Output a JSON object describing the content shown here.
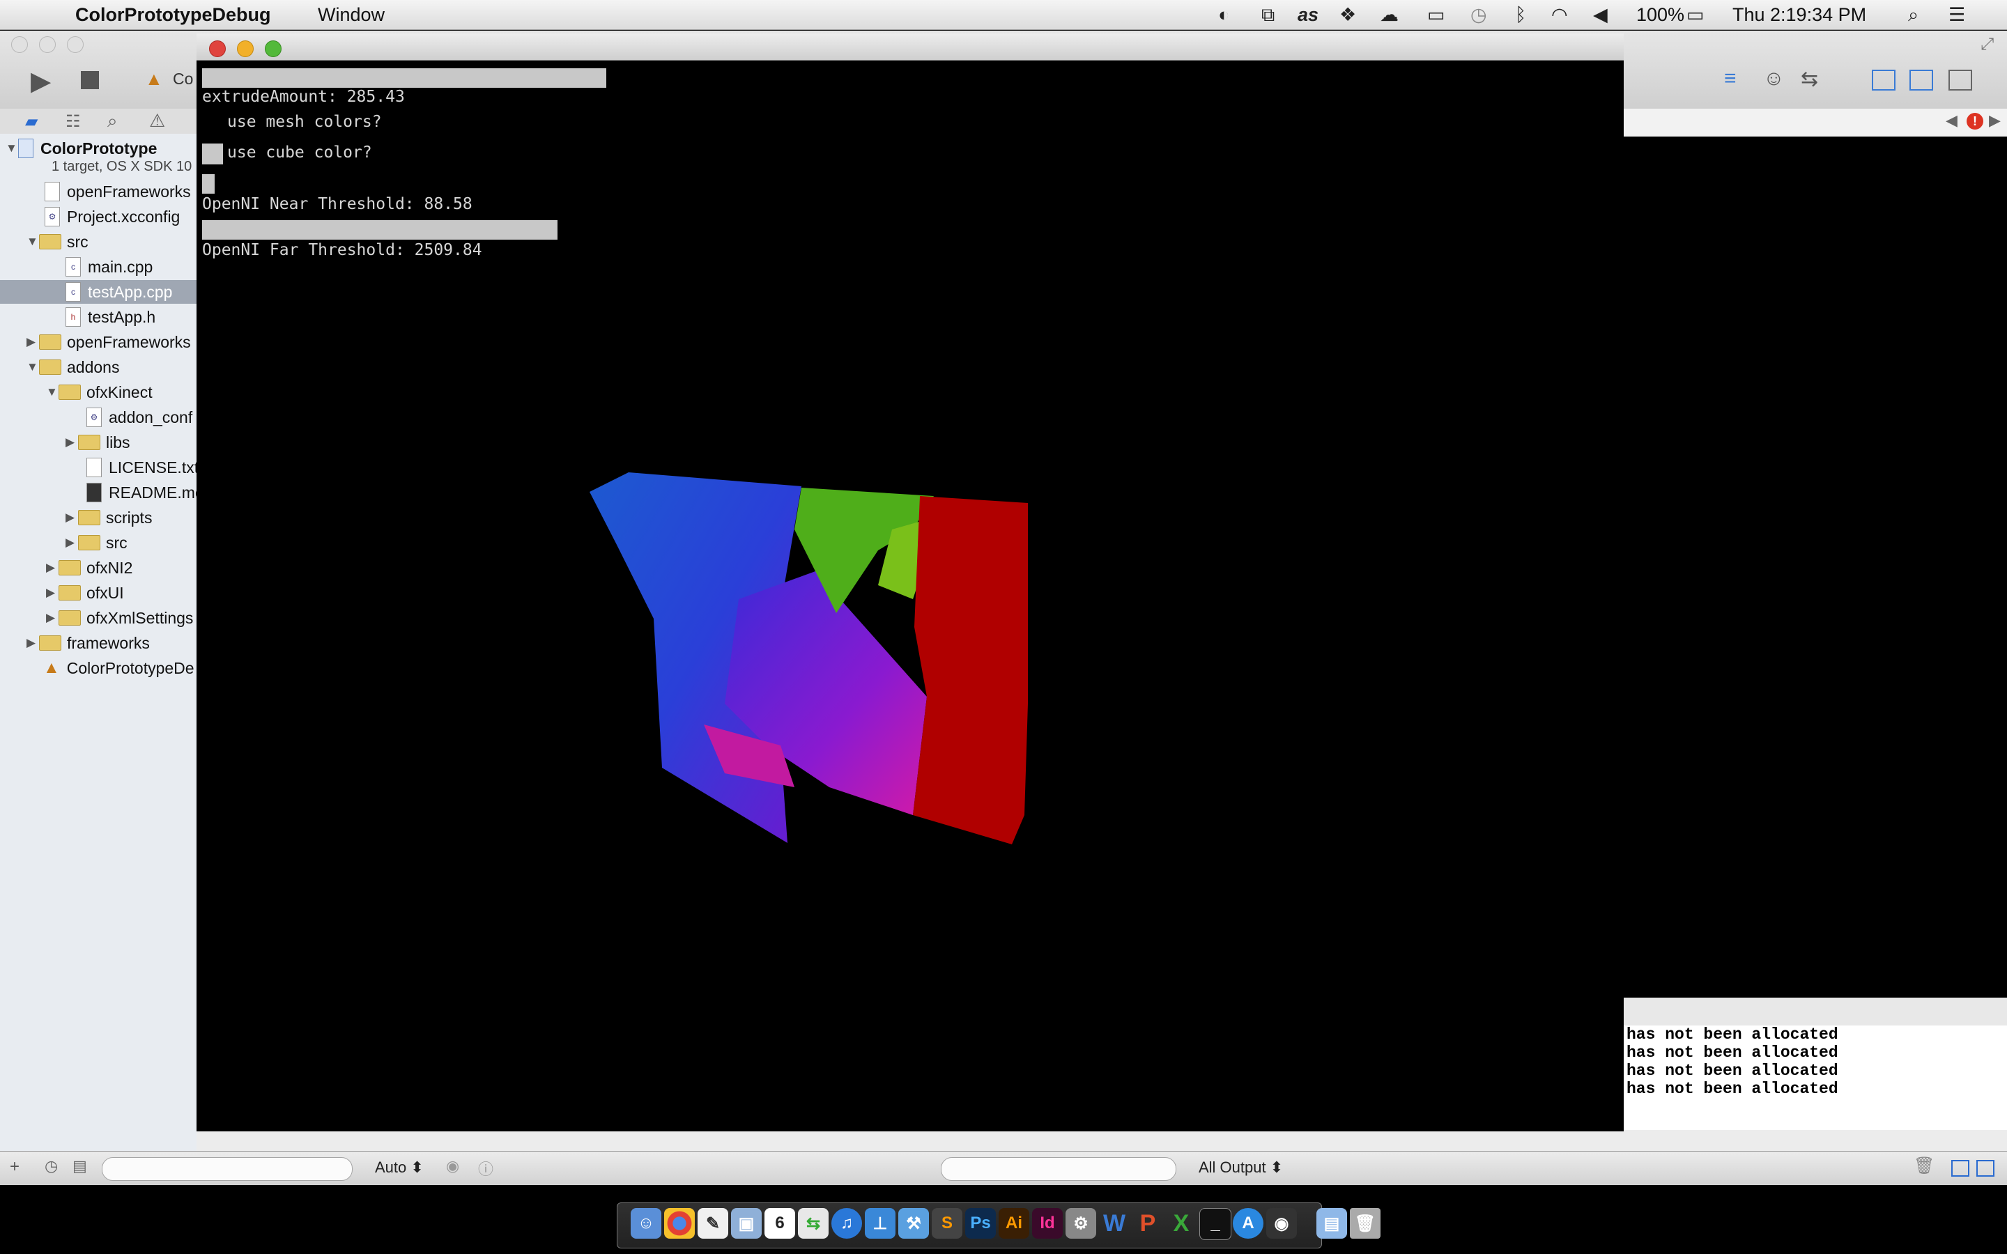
{
  "menubar": {
    "app_name": "ColorPrototypeDebug",
    "menus": [
      "Window"
    ],
    "battery": "100%",
    "clock": "Thu 2:19:34 PM"
  },
  "xcode": {
    "toolbar": {
      "scheme_fragment": "Co"
    },
    "project": {
      "name": "ColorPrototype",
      "subtitle": "1 target, OS X SDK 10"
    },
    "tree": [
      {
        "label": "openFrameworks",
        "kind": "file"
      },
      {
        "label": "Project.xcconfig",
        "kind": "file"
      },
      {
        "label": "src",
        "kind": "folder"
      },
      {
        "label": "main.cpp",
        "kind": "file"
      },
      {
        "label": "testApp.cpp",
        "kind": "file",
        "selected": true
      },
      {
        "label": "testApp.h",
        "kind": "file"
      },
      {
        "label": "openFrameworks",
        "kind": "folder"
      },
      {
        "label": "addons",
        "kind": "folder"
      },
      {
        "label": "ofxKinect",
        "kind": "folder"
      },
      {
        "label": "addon_conf",
        "kind": "file"
      },
      {
        "label": "libs",
        "kind": "folder"
      },
      {
        "label": "LICENSE.txt",
        "kind": "file"
      },
      {
        "label": "README.mo",
        "kind": "file"
      },
      {
        "label": "scripts",
        "kind": "folder"
      },
      {
        "label": "src",
        "kind": "folder"
      },
      {
        "label": "ofxNI2",
        "kind": "folder"
      },
      {
        "label": "ofxUI",
        "kind": "folder"
      },
      {
        "label": "ofxXmlSettings",
        "kind": "folder"
      },
      {
        "label": "frameworks",
        "kind": "folder"
      },
      {
        "label": "ColorPrototypeDe",
        "kind": "target"
      }
    ],
    "debug_bar": {
      "auto_label": "Auto ⬍",
      "output_label": "All Output ⬍"
    },
    "console_lines": [
      "has not been allocated",
      "has not been allocated",
      "has not been allocated",
      "has not been allocated"
    ]
  },
  "app": {
    "gui": {
      "extrude_label": "extrudeAmount: 285.43",
      "mesh_colors_label": "use mesh colors?",
      "cube_color_label": "use cube color?",
      "near_label": "OpenNI Near Threshold: 88.58",
      "far_label": "OpenNI Far Threshold: 2509.84"
    },
    "mesh_colors": [
      "#1d3fd0",
      "#5a1ad0",
      "#c81ad0",
      "#3fbf1a",
      "#b00000"
    ]
  },
  "dock": {
    "apps": [
      "finder-icon",
      "chrome-icon",
      "textedit-icon",
      "preview-icon",
      "calendar-icon",
      "facetime-icon",
      "itunes-icon",
      "keynote-icon",
      "xcode-icon",
      "sublime-icon",
      "photoshop-icon",
      "illustrator-icon",
      "indesign-icon",
      "utility-icon",
      "word-icon",
      "powerpoint-icon",
      "excel-icon",
      "terminal-icon",
      "appstore-icon",
      "camera-icon",
      "downloads-icon",
      "trash-icon"
    ],
    "labels": {
      "photoshop": "Ps",
      "illustrator": "Ai",
      "indesign": "Id",
      "word": "W",
      "powerpoint": "P",
      "excel": "X",
      "calendar": "6"
    }
  }
}
